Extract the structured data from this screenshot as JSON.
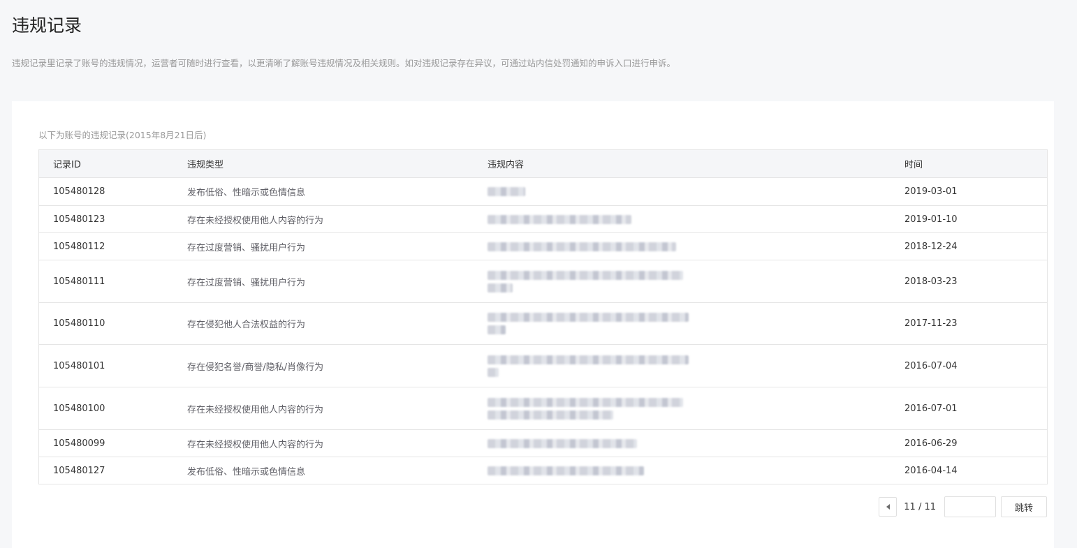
{
  "page": {
    "title": "违规记录",
    "description": "违规记录里记录了账号的违规情况，运营者可随时进行查看，以更清晰了解账号违规情况及相关规则。如对违规记录存在异议，可通过站内信处罚通知的申诉入口进行申诉。"
  },
  "table": {
    "caption": "以下为账号的违规记录(2015年8月21日后)",
    "columns": [
      "记录ID",
      "违规类型",
      "违规内容",
      "时间"
    ],
    "rows": [
      {
        "id": "105480128",
        "type": "发布低俗、性暗示或色情信息",
        "time": "2019-03-01"
      },
      {
        "id": "105480123",
        "type": "存在未经授权使用他人内容的行为",
        "time": "2019-01-10"
      },
      {
        "id": "105480112",
        "type": "存在过度营销、骚扰用户行为",
        "time": "2018-12-24"
      },
      {
        "id": "105480111",
        "type": "存在过度营销、骚扰用户行为",
        "time": "2018-03-23"
      },
      {
        "id": "105480110",
        "type": "存在侵犯他人合法权益的行为",
        "time": "2017-11-23"
      },
      {
        "id": "105480101",
        "type": "存在侵犯名誉/商誉/隐私/肖像行为",
        "time": "2016-07-04"
      },
      {
        "id": "105480100",
        "type": "存在未经授权使用他人内容的行为",
        "time": "2016-07-01"
      },
      {
        "id": "105480099",
        "type": "存在未经授权使用他人内容的行为",
        "time": "2016-06-29"
      },
      {
        "id": "105480127",
        "type": "发布低俗、性暗示或色情信息",
        "time": "2016-04-14"
      }
    ]
  },
  "pagination": {
    "info": "11 / 11",
    "jump_input_value": "",
    "jump_button_label": "跳转",
    "prev_icon": "caret-left-icon"
  }
}
